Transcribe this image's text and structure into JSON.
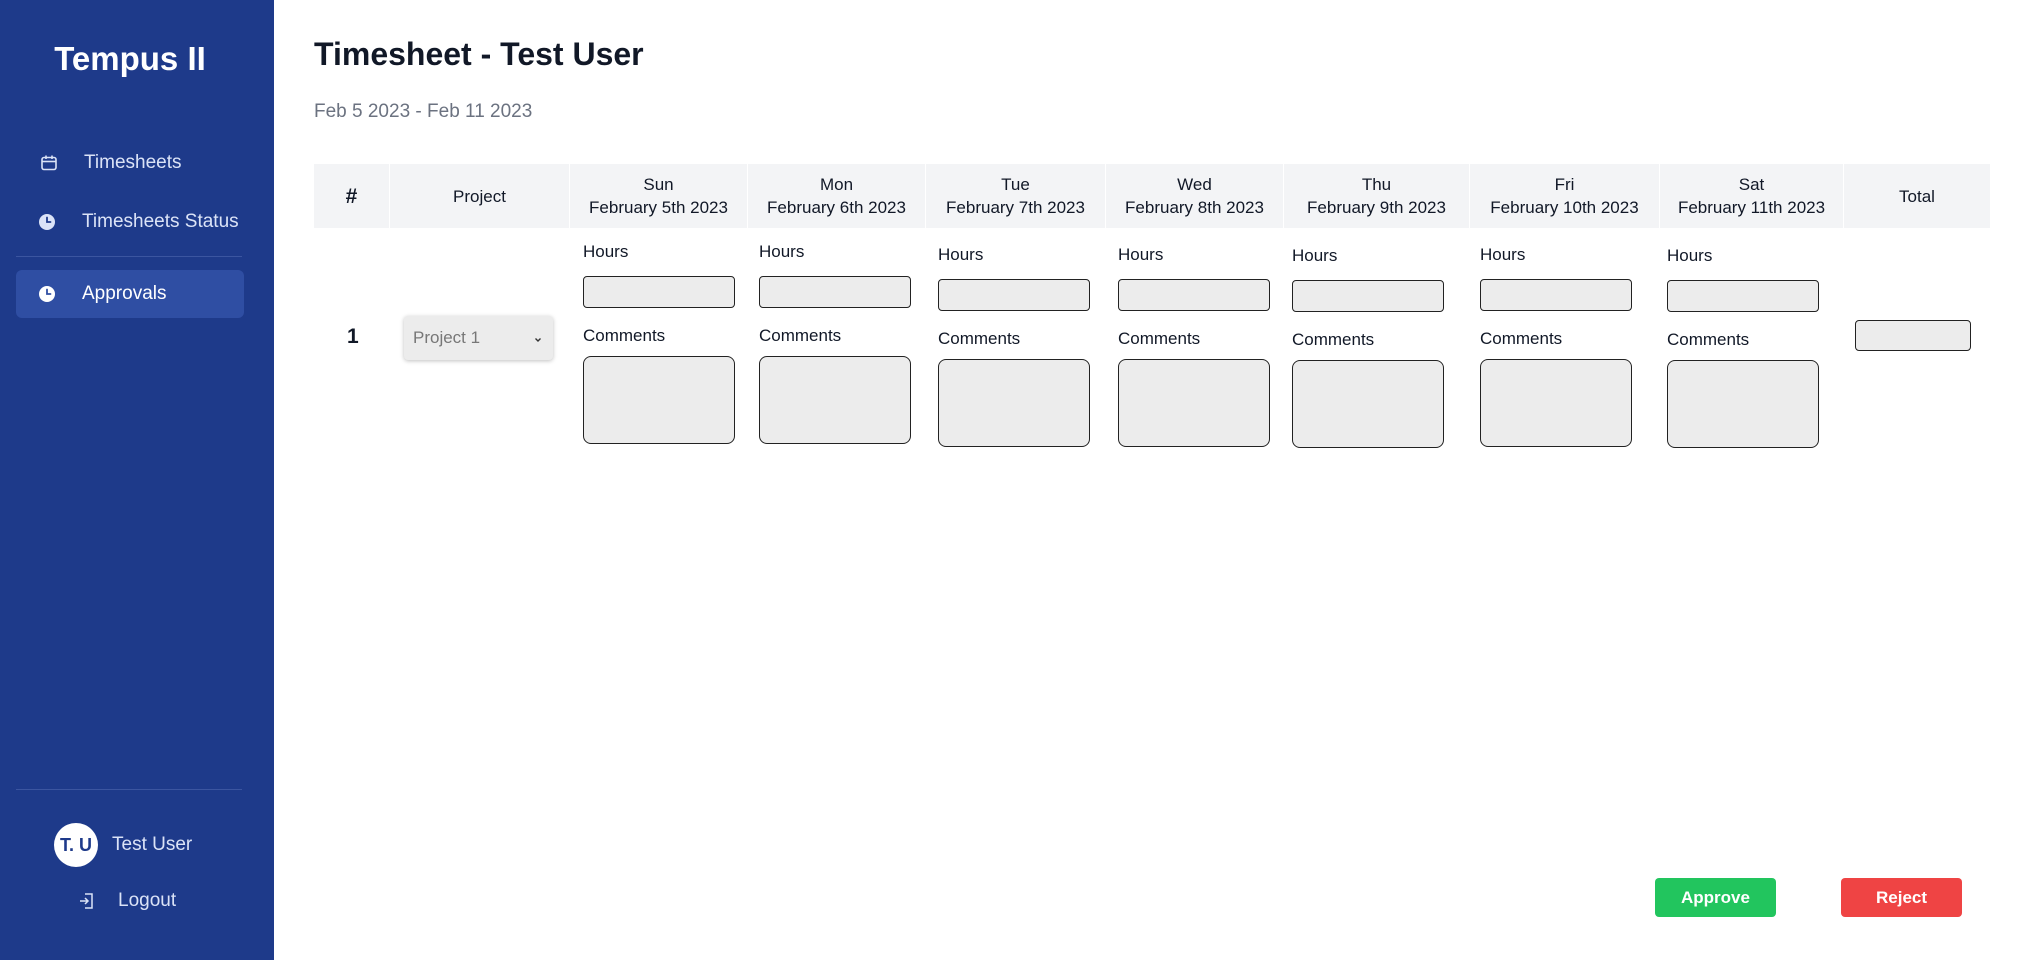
{
  "app": {
    "title": "Tempus II"
  },
  "sidebar": {
    "items": [
      {
        "label": "Timesheets",
        "icon": "calendar-icon"
      },
      {
        "label": "Timesheets Status",
        "icon": "clock-icon"
      },
      {
        "label": "Approvals",
        "icon": "clock-icon",
        "active": true
      }
    ],
    "user": {
      "initials": "T. U",
      "name": "Test User"
    },
    "logout_label": "Logout"
  },
  "page": {
    "title": "Timesheet - Test User",
    "date_range": "Feb 5 2023 - Feb 11 2023"
  },
  "table": {
    "headers": {
      "number": "#",
      "project": "Project",
      "days": [
        {
          "day": "Sun",
          "date": "February 5th 2023"
        },
        {
          "day": "Mon",
          "date": "February 6th 2023"
        },
        {
          "day": "Tue",
          "date": "February 7th 2023"
        },
        {
          "day": "Wed",
          "date": "February 8th 2023"
        },
        {
          "day": "Thu",
          "date": "February 9th 2023"
        },
        {
          "day": "Fri",
          "date": "February 10th 2023"
        },
        {
          "day": "Sat",
          "date": "February 11th 2023"
        }
      ],
      "total": "Total"
    },
    "rows": [
      {
        "number": "1",
        "project": "Project 1",
        "hours_label": "Hours",
        "comments_label": "Comments",
        "hours": [
          "",
          "",
          "",
          "",
          "",
          "",
          ""
        ],
        "comments": [
          "",
          "",
          "",
          "",
          "",
          "",
          ""
        ],
        "total": ""
      }
    ]
  },
  "actions": {
    "approve_label": "Approve",
    "reject_label": "Reject"
  },
  "colors": {
    "sidebar": "#1e3a8a",
    "sidebar_active": "#2f4ea3",
    "approve": "#22c55e",
    "reject": "#ef4444",
    "header_bg": "#f3f4f6",
    "input_bg": "#ececec"
  }
}
